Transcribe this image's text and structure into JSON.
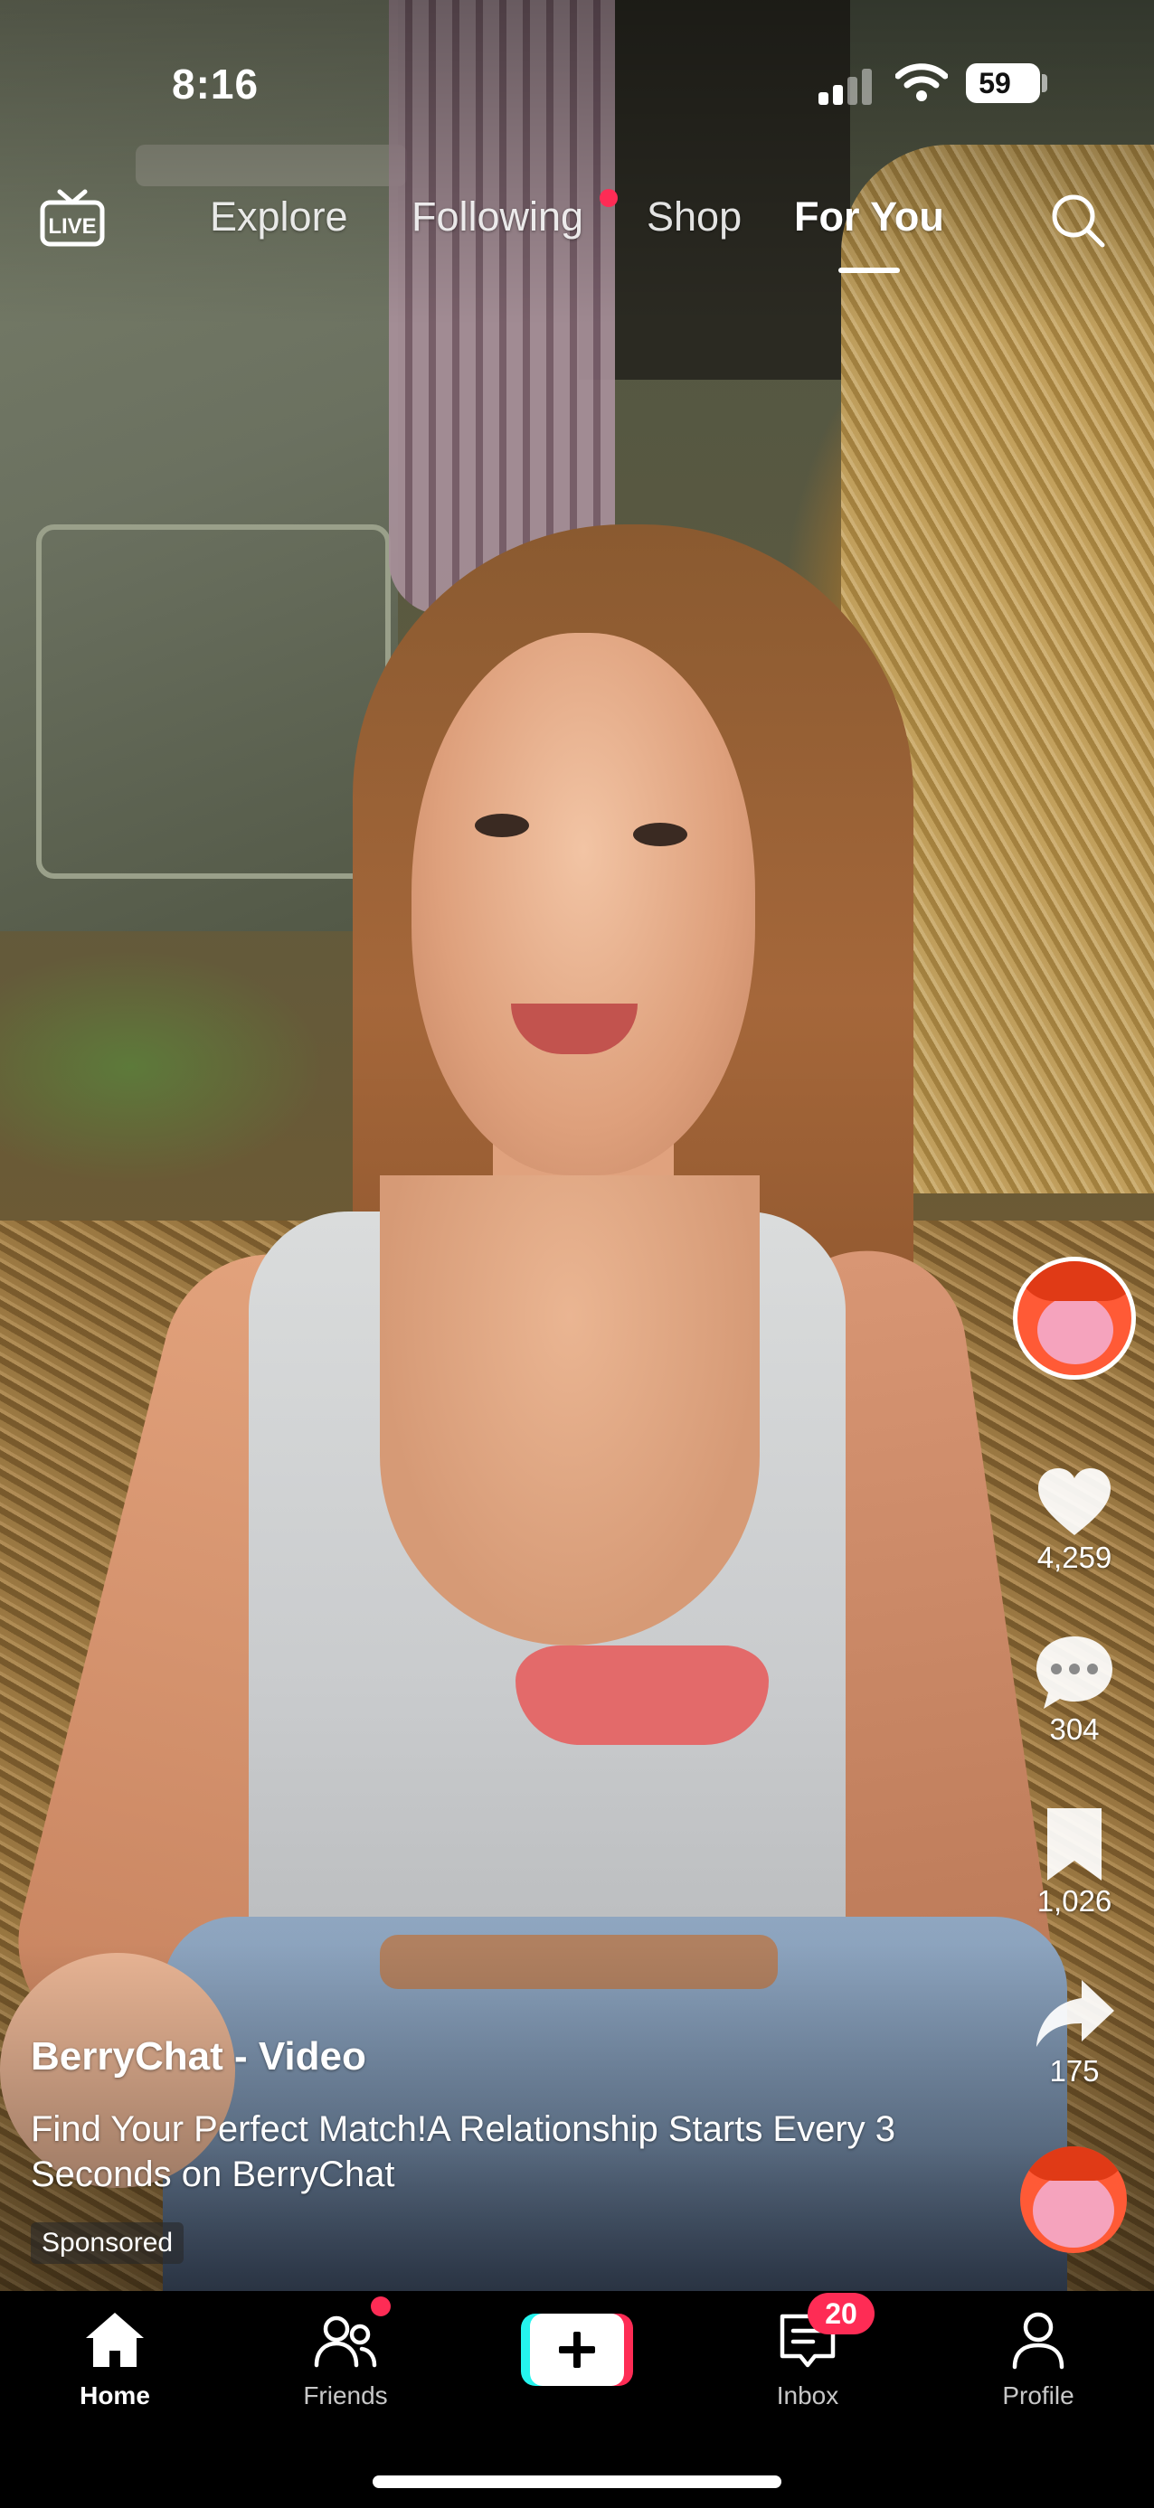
{
  "status_bar": {
    "time": "8:16",
    "battery": "59"
  },
  "top_nav": {
    "tabs": [
      {
        "label": "Explore"
      },
      {
        "label": "Following"
      },
      {
        "label": "Shop"
      },
      {
        "label": "For You"
      }
    ],
    "active_tab": "For You",
    "live_label": "LIVE"
  },
  "right_rail": {
    "likes": "4,259",
    "comments": "304",
    "saves": "1,026",
    "shares": "175"
  },
  "caption": {
    "title": "BerryChat - Video",
    "text": "Find Your Perfect Match!A Relationship Starts Every 3 Seconds on BerryChat",
    "badge": "Sponsored"
  },
  "bottom_nav": {
    "items": [
      {
        "label": "Home"
      },
      {
        "label": "Friends"
      },
      {
        "label": "Inbox"
      },
      {
        "label": "Profile"
      }
    ],
    "inbox_badge": "20"
  },
  "colors": {
    "accent_pink": "#fe2c55",
    "accent_cyan": "#25f4ee",
    "background": "#000000"
  },
  "icons": [
    "live-icon",
    "search-icon",
    "heart-icon",
    "comment-icon",
    "bookmark-icon",
    "share-icon",
    "home-icon",
    "friends-icon",
    "plus-icon",
    "inbox-icon",
    "profile-icon"
  ]
}
